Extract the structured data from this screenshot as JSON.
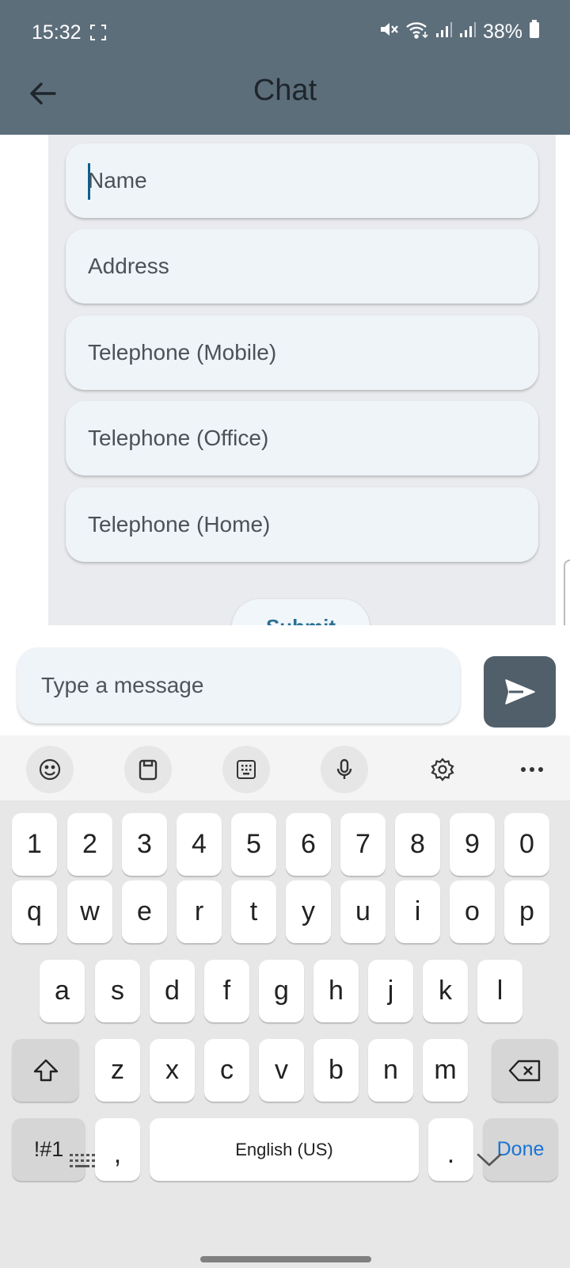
{
  "status_bar": {
    "time": "15:32",
    "battery": "38%",
    "icons": [
      "screenshot-indicator-icon",
      "mute-icon",
      "wifi-icon",
      "signal-icon",
      "signal-icon",
      "battery-icon"
    ]
  },
  "app_bar": {
    "title": "Chat",
    "back_icon": "arrow-left-icon"
  },
  "form": {
    "fields": [
      {
        "placeholder": "Name",
        "focused": true
      },
      {
        "placeholder": "Address"
      },
      {
        "placeholder": "Telephone (Mobile)"
      },
      {
        "placeholder": "Telephone (Office)"
      },
      {
        "placeholder": "Telephone (Home)"
      }
    ],
    "submit_label": "Submit"
  },
  "composer": {
    "placeholder": "Type a message",
    "send_icon": "send-icon"
  },
  "keyboard": {
    "toolbar": [
      "emoji-icon",
      "clipboard-icon",
      "keypad-icon",
      "microphone-icon",
      "settings-icon",
      "more-icon"
    ],
    "number_row": [
      "1",
      "2",
      "3",
      "4",
      "5",
      "6",
      "7",
      "8",
      "9",
      "0"
    ],
    "row1": [
      "q",
      "w",
      "e",
      "r",
      "t",
      "y",
      "u",
      "i",
      "o",
      "p"
    ],
    "row2": [
      "a",
      "s",
      "d",
      "f",
      "g",
      "h",
      "j",
      "k",
      "l"
    ],
    "row3": [
      "z",
      "x",
      "c",
      "v",
      "b",
      "n",
      "m"
    ],
    "symbols_label": "!#1",
    "comma_label": ",",
    "space_label": "English (US)",
    "period_label": ".",
    "done_label": "Done"
  },
  "colors": {
    "app_bar": "#5d6e7b",
    "send_button": "#505f6a",
    "field_bg": "#eef4f8",
    "done_text": "#1a73d6"
  }
}
